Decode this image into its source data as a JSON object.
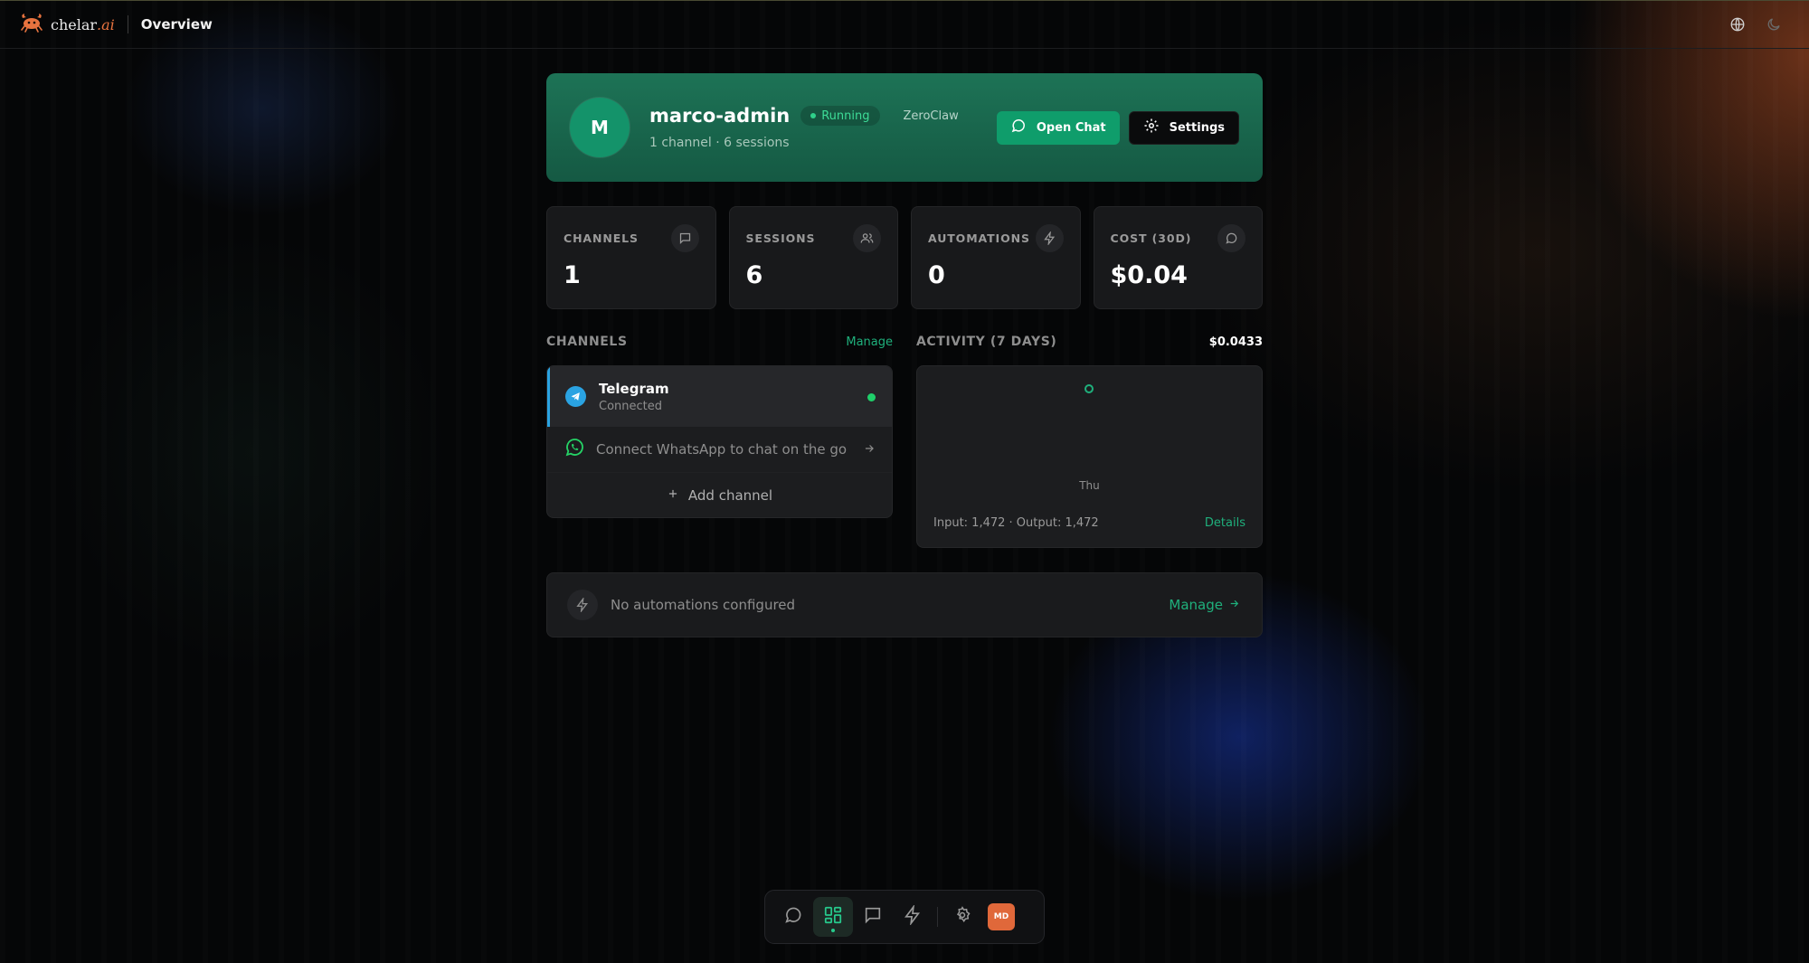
{
  "brand": {
    "name": "chelar",
    "suffix": ".ai",
    "accent": "#e8733f"
  },
  "header": {
    "title": "Overview"
  },
  "agent": {
    "initial": "M",
    "name": "marco-admin",
    "status": "Running",
    "engine": "ZeroClaw",
    "summary": "1 channel · 6 sessions",
    "open_chat_label": "Open Chat",
    "settings_label": "Settings"
  },
  "stats": [
    {
      "label": "CHANNELS",
      "value": "1",
      "icon": "message-square-icon"
    },
    {
      "label": "SESSIONS",
      "value": "6",
      "icon": "users-icon"
    },
    {
      "label": "AUTOMATIONS",
      "value": "0",
      "icon": "zap-icon"
    },
    {
      "label": "COST (30D)",
      "value": "$0.04",
      "icon": "message-circle-icon"
    }
  ],
  "channels": {
    "title": "CHANNELS",
    "manage_label": "Manage",
    "items": [
      {
        "name": "Telegram",
        "status": "Connected",
        "icon": "telegram-icon"
      }
    ],
    "whatsapp_cta": "Connect WhatsApp to chat on the go",
    "add_label": "Add channel"
  },
  "activity": {
    "title": "ACTIVITY (7 DAYS)",
    "total_cost": "$0.0433",
    "tick": "Thu",
    "tokens": "Input: 1,472 · Output: 1,472",
    "details_label": "Details"
  },
  "automations": {
    "empty_text": "No automations configured",
    "manage_label": "Manage"
  },
  "dock": {
    "items": [
      "chat-icon",
      "dashboard-icon",
      "messages-icon",
      "automations-icon",
      "settings-icon"
    ],
    "active": "dashboard-icon",
    "user_initials": "MD"
  },
  "colors": {
    "accent_green": "#1fb07c",
    "hero_green": "#1d7356",
    "telegram_blue": "#2aa3e2",
    "whatsapp_green": "#25d366",
    "avatar_orange": "#e0683a"
  }
}
